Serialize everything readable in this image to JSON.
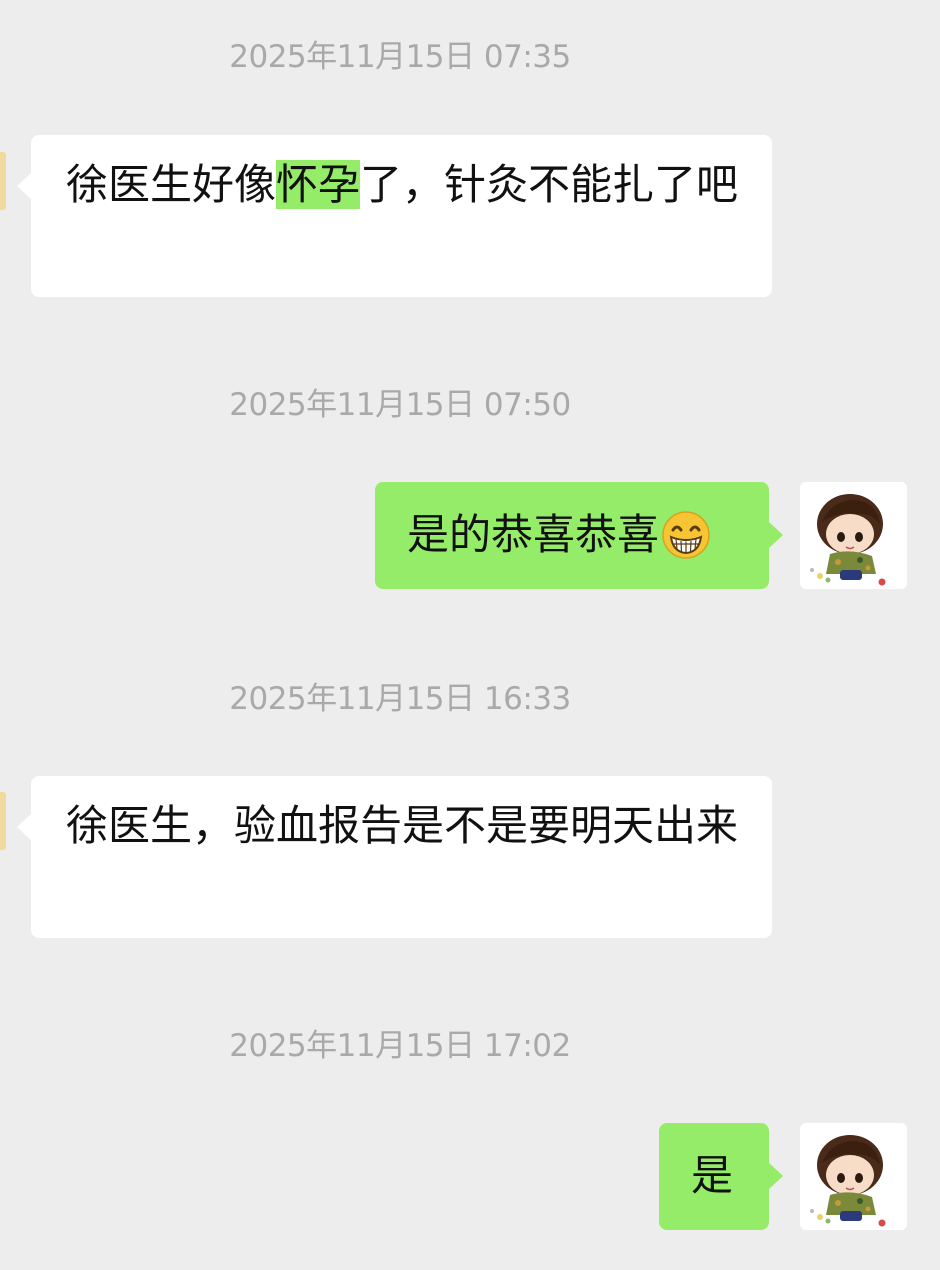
{
  "chat": {
    "messages": [
      {
        "timestamp": "2025年11月15日 07:35",
        "direction": "incoming",
        "text_before": "徐医生好像",
        "text_highlight": "怀孕",
        "text_after": "了，针灸不能扎了吧"
      },
      {
        "timestamp": "2025年11月15日 07:50",
        "direction": "outgoing",
        "text": "是的恭喜恭喜",
        "emoji": "grinning-face-emoji"
      },
      {
        "timestamp": "2025年11月15日 16:33",
        "direction": "incoming",
        "text": "徐医生，验血报告是不是要明天出来"
      },
      {
        "timestamp": "2025年11月15日 17:02",
        "direction": "outgoing",
        "text": "是"
      }
    ]
  },
  "colors": {
    "background": "#ededed",
    "incoming_bubble": "#ffffff",
    "outgoing_bubble": "#95ec69",
    "highlight": "#95ec69",
    "timestamp": "#a9a9a9"
  },
  "icons": {
    "avatar": "cartoon-boy-avatar",
    "emoji": "grinning-face-emoji"
  }
}
